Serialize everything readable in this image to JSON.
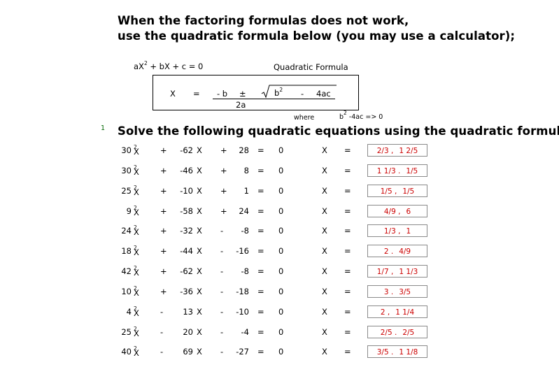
{
  "header": {
    "line1": "When the factoring formulas does not work,",
    "line2": "use the quadratic formula below (you may use a calculator);"
  },
  "formula": {
    "standard_form_pre": "aX",
    "standard_form_sup": "2",
    "standard_form_post": " + bX + c = 0",
    "title": "Quadratic Formula",
    "x": "X",
    "eq": "=",
    "minus_b": "- b",
    "plus_minus": "±",
    "b": "b",
    "b_sup": "2",
    "minus": "-",
    "four_ac": "4ac",
    "denominator": "2a",
    "where": "where",
    "condition_pre": "b",
    "condition_sup": "2",
    "condition_post": " -4ac => 0"
  },
  "problem": {
    "number": "1",
    "instruction": "Solve the following quadratic equations using the quadratic formula."
  },
  "equations": [
    {
      "a": "30",
      "op1": "+",
      "b": "-62",
      "op2": "+",
      "c": "28",
      "ans1": "2/3 ,",
      "ans2": "1 2/5"
    },
    {
      "a": "30",
      "op1": "+",
      "b": "-46",
      "op2": "+",
      "c": "8",
      "ans1": "1 1/3 .",
      "ans2": "1/5"
    },
    {
      "a": "25",
      "op1": "+",
      "b": "-10",
      "op2": "+",
      "c": "1",
      "ans1": "1/5 ,",
      "ans2": "1/5"
    },
    {
      "a": "9",
      "op1": "+",
      "b": "-58",
      "op2": "+",
      "c": "24",
      "ans1": "4/9 ,",
      "ans2": "6"
    },
    {
      "a": "24",
      "op1": "+",
      "b": "-32",
      "op2": "-",
      "c": "-8",
      "ans1": "1/3 ,",
      "ans2": "1"
    },
    {
      "a": "18",
      "op1": "+",
      "b": "-44",
      "op2": "-",
      "c": "-16",
      "ans1": "2 .",
      "ans2": "4/9"
    },
    {
      "a": "42",
      "op1": "+",
      "b": "-62",
      "op2": "-",
      "c": "-8",
      "ans1": "1/7 ,",
      "ans2": "1 1/3"
    },
    {
      "a": "10",
      "op1": "+",
      "b": "-36",
      "op2": "-",
      "c": "-18",
      "ans1": "3 .",
      "ans2": "3/5"
    },
    {
      "a": "4",
      "op1": "-",
      "b": "13",
      "op2": "-",
      "c": "-10",
      "ans1": "2 ,",
      "ans2": "1 1/4"
    },
    {
      "a": "25",
      "op1": "-",
      "b": "20",
      "op2": "-",
      "c": "-4",
      "ans1": "2/5 .",
      "ans2": "2/5"
    },
    {
      "a": "40",
      "op1": "-",
      "b": "69",
      "op2": "-",
      "c": "-27",
      "ans1": "3/5 .",
      "ans2": "1 1/8"
    }
  ],
  "symbols": {
    "x": "X",
    "sup2": "2",
    "eq": "=",
    "zero": "0"
  },
  "colors": {
    "answer_text": "#cc0000",
    "problem_number": "#006600",
    "answer_border": "#8a8a8a"
  }
}
